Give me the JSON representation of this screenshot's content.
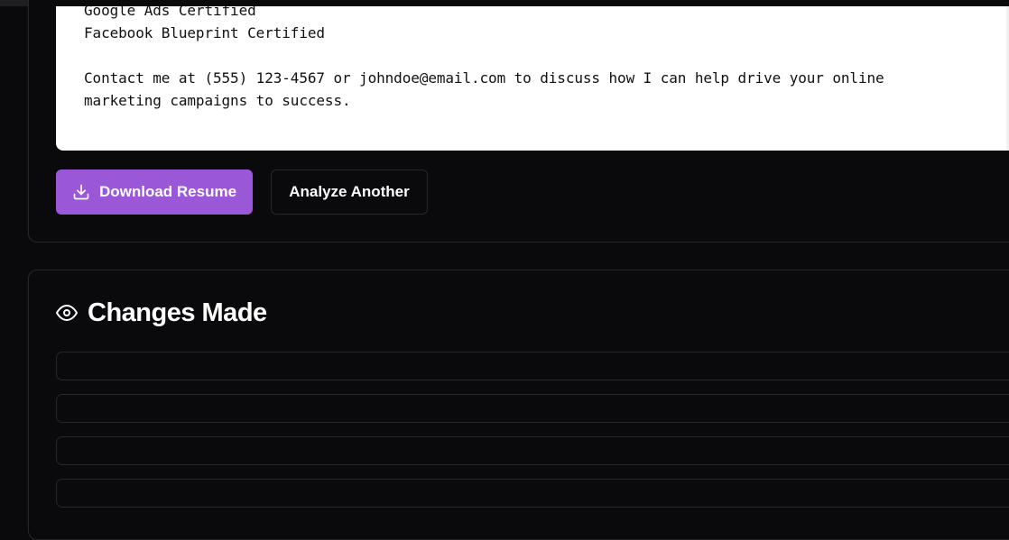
{
  "resume_preview": {
    "text_lines": [
      "Google Ads Certified",
      "Facebook Blueprint Certified",
      "",
      "Contact me at (555) 123-4567 or johndoe@email.com to discuss how I can help drive your online",
      "marketing campaigns to success."
    ]
  },
  "actions": {
    "download_label": "Download Resume",
    "download_icon": "download-icon",
    "analyze_label": "Analyze Another"
  },
  "changes_section": {
    "title": "Changes Made",
    "title_icon": "eye-icon",
    "items": [
      "",
      "",
      "",
      ""
    ]
  },
  "colors": {
    "background": "#0a0a0c",
    "accent": "#9a57d8",
    "border": "#27272a",
    "text_area_bg": "#ffffff"
  }
}
